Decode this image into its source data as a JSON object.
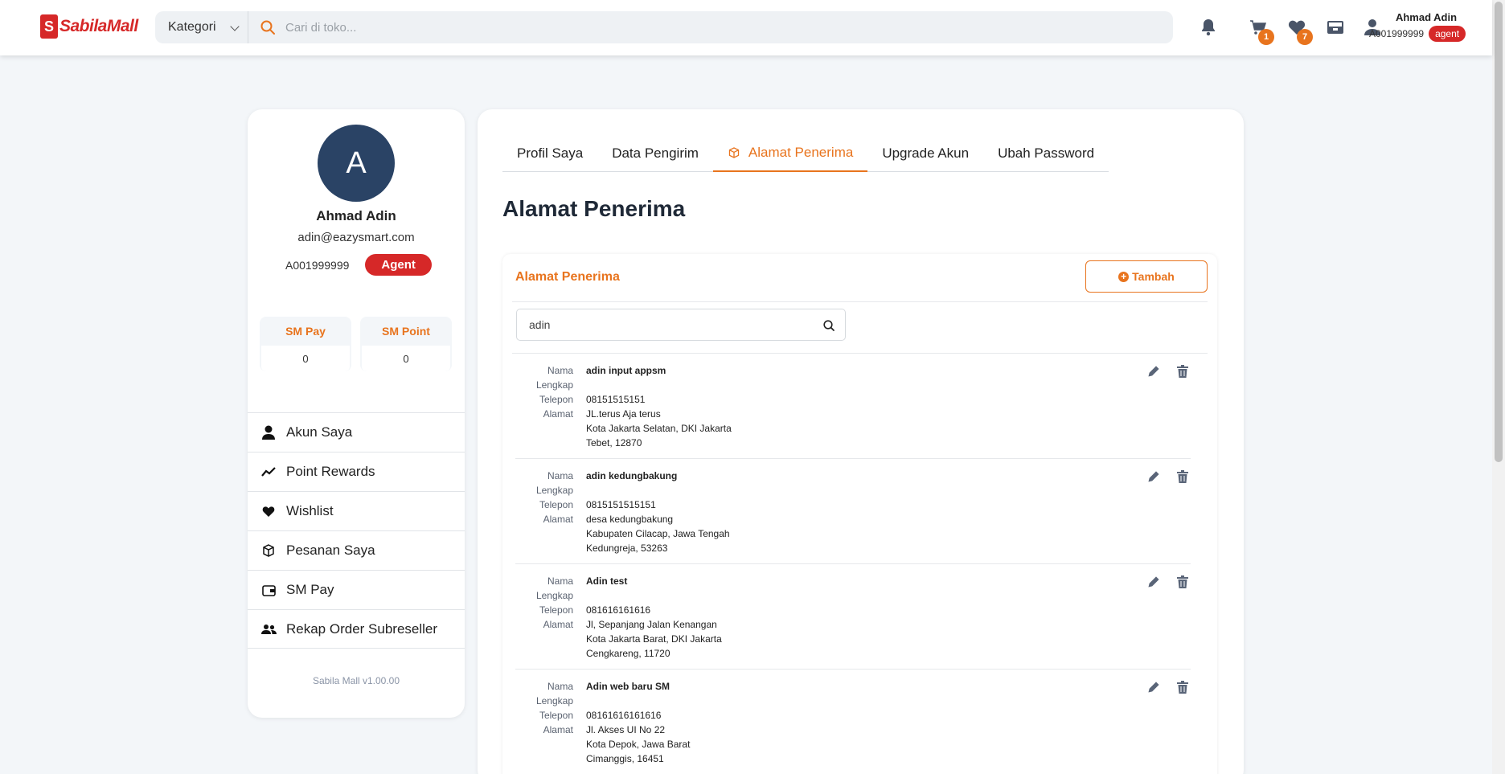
{
  "header": {
    "logo_s": "S",
    "logo_text": "SabilaMall",
    "kategori_label": "Kategori",
    "search_placeholder": "Cari di toko...",
    "cart_badge": "1",
    "wishlist_badge": "7",
    "user_name": "Ahmad Adin",
    "user_id": "A001999999",
    "user_role": "agent"
  },
  "profile": {
    "avatar_letter": "A",
    "name": "Ahmad Adin",
    "email": "adin@eazysmart.com",
    "id": "A001999999",
    "role_badge": "Agent",
    "sm_pay_label": "SM Pay",
    "sm_pay_value": "0",
    "sm_point_label": "SM Point",
    "sm_point_value": "0"
  },
  "menu": {
    "items": [
      {
        "label": "Akun Saya",
        "icon": "user-icon"
      },
      {
        "label": "Point Rewards",
        "icon": "trend-icon"
      },
      {
        "label": "Wishlist",
        "icon": "heart-icon"
      },
      {
        "label": "Pesanan Saya",
        "icon": "box-icon"
      },
      {
        "label": "SM Pay",
        "icon": "wallet-icon"
      },
      {
        "label": "Rekap Order Subreseller",
        "icon": "users-icon"
      }
    ],
    "version": "Sabila Mall v1.00.00"
  },
  "tabs": [
    "Profil Saya",
    "Data Pengirim",
    "Alamat Penerima",
    "Upgrade Akun",
    "Ubah Password"
  ],
  "page_title": "Alamat Penerima",
  "card": {
    "title": "Alamat Penerima",
    "add_button": "Tambah",
    "search_value": "adin"
  },
  "labels": {
    "name": "Nama Lengkap",
    "phone": "Telepon",
    "address": "Alamat"
  },
  "addresses": [
    {
      "name": "adin input appsm",
      "phone": "08151515151",
      "line1": "JL.terus Aja terus",
      "line2": "Kota Jakarta Selatan, DKI Jakarta",
      "line3": "Tebet, 12870"
    },
    {
      "name": "adin kedungbakung",
      "phone": "0815151515151",
      "line1": "desa kedungbakung",
      "line2": "Kabupaten Cilacap, Jawa Tengah",
      "line3": "Kedungreja, 53263"
    },
    {
      "name": "Adin test",
      "phone": "081616161616",
      "line1": "Jl, Sepanjang Jalan Kenangan",
      "line2": "Kota Jakarta Barat, DKI Jakarta",
      "line3": "Cengkareng, 11720"
    },
    {
      "name": "Adin web baru SM",
      "phone": "08161616161616",
      "line1": "Jl. Akses UI No 22",
      "line2": "Kota Depok, Jawa Barat",
      "line3": "Cimanggis, 16451"
    }
  ],
  "colors": {
    "accent": "#e8741e",
    "brand": "#d62828",
    "avatar": "#2a4365"
  }
}
